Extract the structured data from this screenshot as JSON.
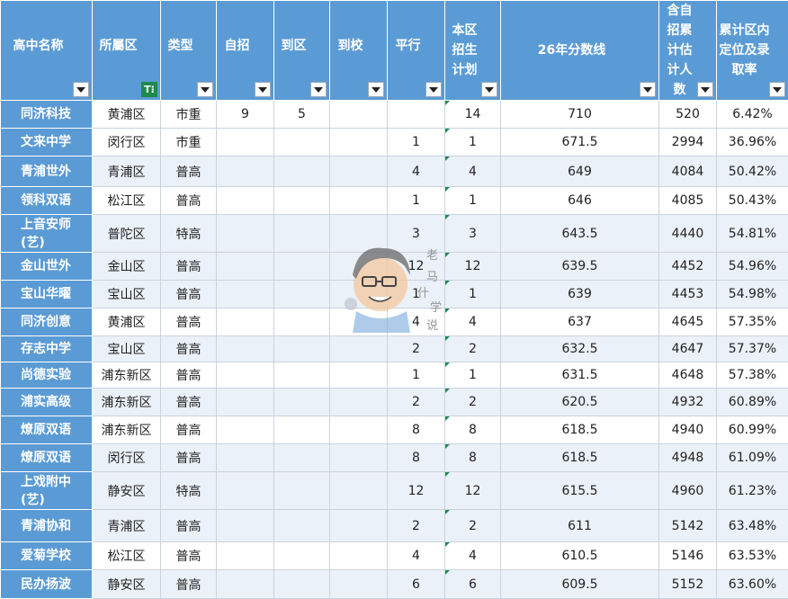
{
  "headers": [
    {
      "label": "高中名称",
      "filter": "arrow"
    },
    {
      "label": "所屬区",
      "filter": "funnel"
    },
    {
      "label": "类型",
      "filter": "arrow"
    },
    {
      "label": "自招",
      "filter": "arrow"
    },
    {
      "label": "到区",
      "filter": "arrow"
    },
    {
      "label": "到校",
      "filter": "arrow"
    },
    {
      "label": "平行",
      "filter": "arrow"
    },
    {
      "label": "本区招生计划",
      "filter": "arrow"
    },
    {
      "label": "26年分数线",
      "filter": "arrow"
    },
    {
      "label": "含自招累计估计人数",
      "filter": "arrow"
    },
    {
      "label": "累计区内定位及录取率",
      "filter": "arrow"
    }
  ],
  "filter_glyph": "T⁝",
  "rows": [
    {
      "name": "同济科技",
      "district": "黄浦区",
      "type": "市重",
      "zizhao": "9",
      "daoqu": "5",
      "daoxiao": "",
      "pingxing": "",
      "plan": "14",
      "score": "710",
      "cumulative": "520",
      "rate": "6.42%"
    },
    {
      "name": "文来中学",
      "district": "闵行区",
      "type": "市重",
      "zizhao": "",
      "daoqu": "",
      "daoxiao": "",
      "pingxing": "1",
      "plan": "1",
      "score": "671.5",
      "cumulative": "2994",
      "rate": "36.96%"
    },
    {
      "name": "青浦世外",
      "district": "青浦区",
      "type": "普高",
      "zizhao": "",
      "daoqu": "",
      "daoxiao": "",
      "pingxing": "4",
      "plan": "4",
      "score": "649",
      "cumulative": "4084",
      "rate": "50.42%"
    },
    {
      "name": "领科双语",
      "district": "松江区",
      "type": "普高",
      "zizhao": "",
      "daoqu": "",
      "daoxiao": "",
      "pingxing": "1",
      "plan": "1",
      "score": "646",
      "cumulative": "4085",
      "rate": "50.43%"
    },
    {
      "name": "上音安师(艺)",
      "district": "普陀区",
      "type": "特高",
      "zizhao": "",
      "daoqu": "",
      "daoxiao": "",
      "pingxing": "3",
      "plan": "3",
      "score": "643.5",
      "cumulative": "4440",
      "rate": "54.81%"
    },
    {
      "name": "金山世外",
      "district": "金山区",
      "type": "普高",
      "zizhao": "",
      "daoqu": "",
      "daoxiao": "",
      "pingxing": "12",
      "plan": "12",
      "score": "639.5",
      "cumulative": "4452",
      "rate": "54.96%"
    },
    {
      "name": "宝山华曜",
      "district": "宝山区",
      "type": "普高",
      "zizhao": "",
      "daoqu": "",
      "daoxiao": "",
      "pingxing": "1",
      "plan": "1",
      "score": "639",
      "cumulative": "4453",
      "rate": "54.98%"
    },
    {
      "name": "同济创意",
      "district": "黄浦区",
      "type": "普高",
      "zizhao": "",
      "daoqu": "",
      "daoxiao": "",
      "pingxing": "4",
      "plan": "4",
      "score": "637",
      "cumulative": "4645",
      "rate": "57.35%"
    },
    {
      "name": "存志中学",
      "district": "宝山区",
      "type": "普高",
      "zizhao": "",
      "daoqu": "",
      "daoxiao": "",
      "pingxing": "2",
      "plan": "2",
      "score": "632.5",
      "cumulative": "4647",
      "rate": "57.37%"
    },
    {
      "name": "尚德实验",
      "district": "浦东新区",
      "type": "普高",
      "zizhao": "",
      "daoqu": "",
      "daoxiao": "",
      "pingxing": "1",
      "plan": "1",
      "score": "631.5",
      "cumulative": "4648",
      "rate": "57.38%"
    },
    {
      "name": "浦实高级",
      "district": "浦东新区",
      "type": "普高",
      "zizhao": "",
      "daoqu": "",
      "daoxiao": "",
      "pingxing": "2",
      "plan": "2",
      "score": "620.5",
      "cumulative": "4932",
      "rate": "60.89%"
    },
    {
      "name": "燎原双语",
      "district": "浦东新区",
      "type": "普高",
      "zizhao": "",
      "daoqu": "",
      "daoxiao": "",
      "pingxing": "8",
      "plan": "8",
      "score": "618.5",
      "cumulative": "4940",
      "rate": "60.99%"
    },
    {
      "name": "燎原双语",
      "district": "闵行区",
      "type": "普高",
      "zizhao": "",
      "daoqu": "",
      "daoxiao": "",
      "pingxing": "8",
      "plan": "8",
      "score": "618.5",
      "cumulative": "4948",
      "rate": "61.09%"
    },
    {
      "name": "上戏附中(艺)",
      "district": "静安区",
      "type": "特高",
      "zizhao": "",
      "daoqu": "",
      "daoxiao": "",
      "pingxing": "12",
      "plan": "12",
      "score": "615.5",
      "cumulative": "4960",
      "rate": "61.23%"
    },
    {
      "name": "青浦协和",
      "district": "青浦区",
      "type": "普高",
      "zizhao": "",
      "daoqu": "",
      "daoxiao": "",
      "pingxing": "2",
      "plan": "2",
      "score": "611",
      "cumulative": "5142",
      "rate": "63.48%"
    },
    {
      "name": "爱菊学校",
      "district": "松江区",
      "type": "普高",
      "zizhao": "",
      "daoqu": "",
      "daoxiao": "",
      "pingxing": "4",
      "plan": "4",
      "score": "610.5",
      "cumulative": "5146",
      "rate": "63.53%"
    },
    {
      "name": "民办扬波",
      "district": "静安区",
      "type": "普高",
      "zizhao": "",
      "daoqu": "",
      "daoxiao": "",
      "pingxing": "6",
      "plan": "6",
      "score": "609.5",
      "cumulative": "5152",
      "rate": "63.60%"
    }
  ],
  "watermark": {
    "label_chars": [
      "老",
      "马",
      "什",
      "学",
      "说"
    ],
    "icon": "cartoon-teacher-avatar"
  },
  "colors": {
    "header_bg": "#5b9bd5",
    "row_alt_bg": "#ebf1f8",
    "filter_active": "#1e8a4b"
  }
}
